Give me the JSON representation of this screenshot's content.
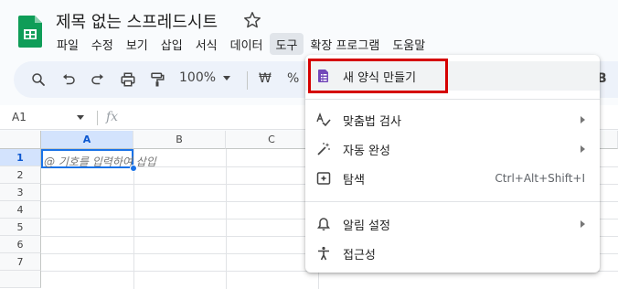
{
  "document": {
    "title": "제목 없는 스프레드시트"
  },
  "menubar": {
    "items": [
      {
        "label": "파일"
      },
      {
        "label": "수정"
      },
      {
        "label": "보기"
      },
      {
        "label": "삽입"
      },
      {
        "label": "서식"
      },
      {
        "label": "데이터"
      },
      {
        "label": "도구"
      },
      {
        "label": "확장 프로그램"
      },
      {
        "label": "도움말"
      }
    ]
  },
  "toolbar": {
    "zoom": "100%",
    "currency": "₩",
    "percent": "%",
    "bold": "B"
  },
  "formula_bar": {
    "namebox": "A1",
    "fx": "fx"
  },
  "grid": {
    "columns": [
      "A",
      "B",
      "C"
    ],
    "rows": [
      "1",
      "2",
      "3",
      "4",
      "5",
      "6",
      "7"
    ],
    "cell_hint": "@ 기호를 입력하여 삽입"
  },
  "tools_menu": {
    "items": [
      {
        "label": "새 양식 만들기",
        "icon": "forms-icon"
      },
      {
        "label": "맞춤법 검사",
        "icon": "spellcheck-icon"
      },
      {
        "label": "자동 완성",
        "icon": "autocomplete-wand-icon"
      },
      {
        "label": "탐색",
        "icon": "explore-icon",
        "shortcut": "Ctrl+Alt+Shift+I"
      },
      {
        "label": "알림 설정",
        "icon": "bell-icon"
      },
      {
        "label": "접근성",
        "icon": "accessibility-icon"
      }
    ]
  },
  "colors": {
    "accent": "#1a73e8",
    "highlight": "#d50000",
    "sheets_green": "#0f9d58",
    "forms_purple": "#7248b9"
  }
}
